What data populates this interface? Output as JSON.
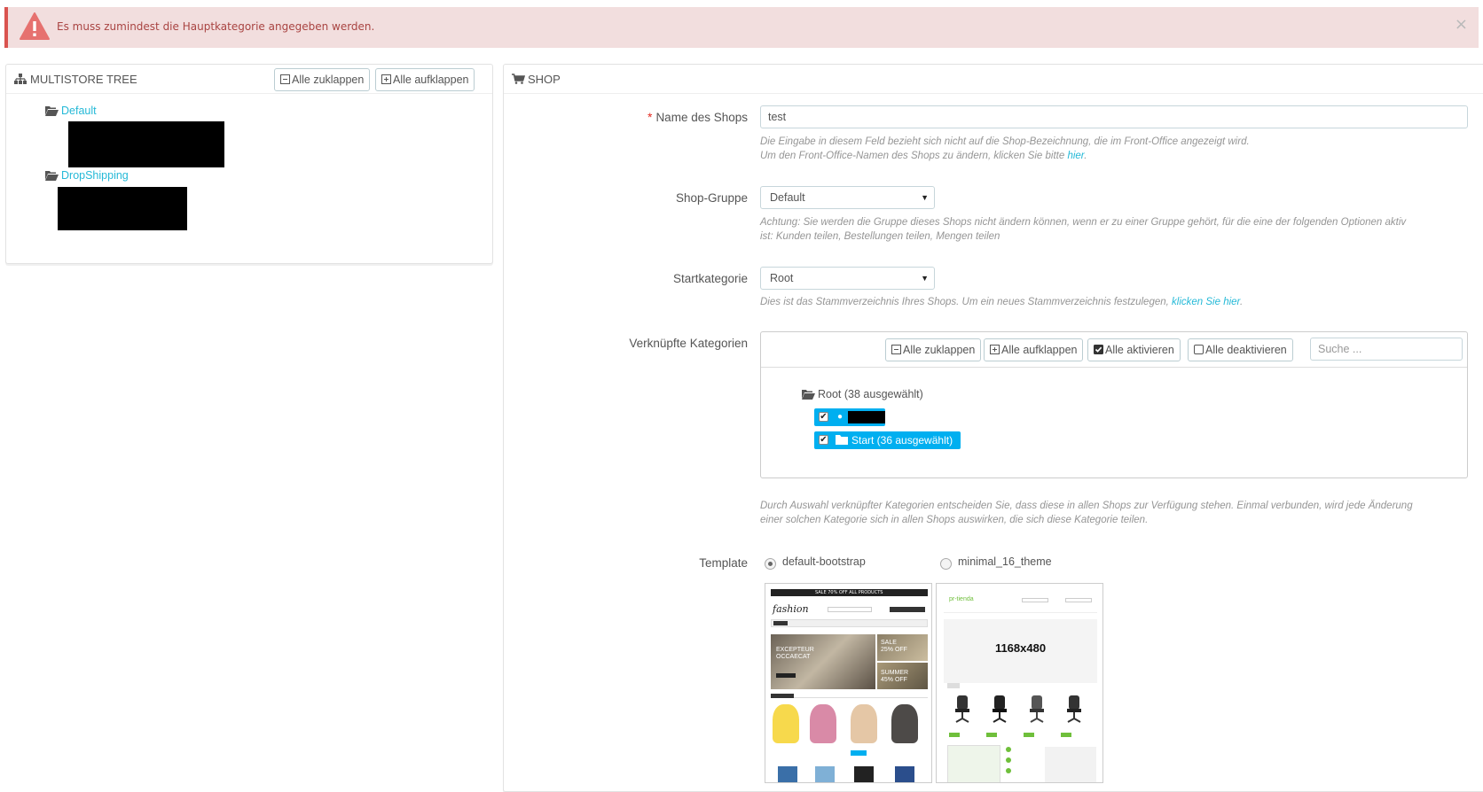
{
  "alert": {
    "message": "Es muss zumindest die Hauptkategorie angegeben werden.",
    "close": "×",
    "color": "#f2dede"
  },
  "tree_panel": {
    "title": "MULTISTORE TREE",
    "icon": "sitemap-icon",
    "collapse_all": "Alle zuklappen",
    "expand_all": "Alle aufklappen",
    "groups": [
      {
        "name": "Default"
      },
      {
        "name": "DropShipping"
      }
    ]
  },
  "shop_panel": {
    "title": "SHOP",
    "icon": "cart-icon",
    "shop_name": {
      "required_mark": "*",
      "label": "Name des Shops",
      "value": "test",
      "help_line1": "Die Eingabe in diesem Feld bezieht sich nicht auf die Shop-Bezeichnung, die im Front-Office angezeigt wird.",
      "help_line2_prefix": "Um den Front-Office-Namen des Shops zu ändern, klicken Sie bitte ",
      "help_link": "hier",
      "help_line2_suffix": "."
    },
    "shop_group": {
      "label": "Shop-Gruppe",
      "value": "Default",
      "help_line1": "Achtung: Sie werden die Gruppe dieses Shops nicht ändern können, wenn er zu einer Gruppe gehört, für die eine der folgenden Optionen aktiv",
      "help_line2": "ist: Kunden teilen, Bestellungen teilen, Mengen teilen"
    },
    "start_category": {
      "label": "Startkategorie",
      "value": "Root",
      "help_prefix": "Dies ist das Stammverzeichnis Ihres Shops. Um ein neues Stammverzeichnis festzulegen, ",
      "help_link": "klicken Sie hier",
      "help_suffix": "."
    },
    "linked_categories": {
      "label": "Verknüpfte Kategorien",
      "collapse_all": "Alle zuklappen",
      "expand_all": "Alle aufklappen",
      "check_all": "Alle aktivieren",
      "uncheck_all": "Alle deaktivieren",
      "search_placeholder": "Suche ...",
      "root_label": "Root (38 ausgewählt)",
      "child_label": "Start (36 ausgewählt)",
      "help_line1": "Durch Auswahl verknüpfter Kategorien entscheiden Sie, dass diese in allen Shops zur Verfügung stehen. Einmal verbunden, wird jede Änderung",
      "help_line2": "einer solchen Kategorie sich in allen Shops auswirken, die sich diese Kategorie teilen."
    },
    "template": {
      "label": "Template",
      "options": [
        {
          "name": "default-bootstrap",
          "selected": true
        },
        {
          "name": "minimal_16_theme",
          "selected": false
        }
      ],
      "preview1": {
        "promo": "SALE 70% OFF ALL PRODUCTS",
        "logo": "fashion",
        "hero": "EXCEPTEUR OCCAECAT",
        "sale1": "SALE 25% OFF",
        "sale2": "SUMMER 45% OFF"
      },
      "preview2": {
        "logo": "pr-tienda",
        "banner": "1168x480"
      }
    }
  },
  "colors": {
    "link": "#25b9d7",
    "selection": "#00aff0",
    "required": "#e3281f"
  }
}
